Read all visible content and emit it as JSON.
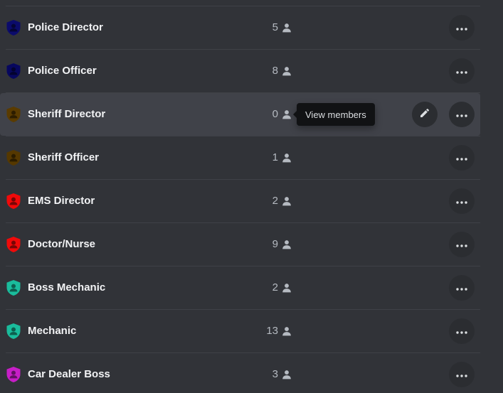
{
  "roles": [
    {
      "name": "Police Director",
      "count": "5",
      "color": "#0b0b6b",
      "hovered": false
    },
    {
      "name": "Police Officer",
      "count": "8",
      "color": "#07075e",
      "hovered": false
    },
    {
      "name": "Sheriff Director",
      "count": "0",
      "color": "#5a3b00",
      "hovered": true
    },
    {
      "name": "Sheriff Officer",
      "count": "1",
      "color": "#553800",
      "hovered": false
    },
    {
      "name": "EMS Director",
      "count": "2",
      "color": "#f00a0a",
      "hovered": false
    },
    {
      "name": "Doctor/Nurse",
      "count": "9",
      "color": "#f00a0a",
      "hovered": false
    },
    {
      "name": "Boss Mechanic",
      "count": "2",
      "color": "#1abc9c",
      "hovered": false
    },
    {
      "name": "Mechanic",
      "count": "13",
      "color": "#1abc9c",
      "hovered": false
    },
    {
      "name": "Car Dealer Boss",
      "count": "3",
      "color": "#c71ec7",
      "hovered": false
    }
  ],
  "tooltip": {
    "text": "View members"
  },
  "icons": {
    "role": "shield-person-icon",
    "members": "person-icon",
    "more": "more-horizontal-icon",
    "edit": "pencil-icon"
  }
}
